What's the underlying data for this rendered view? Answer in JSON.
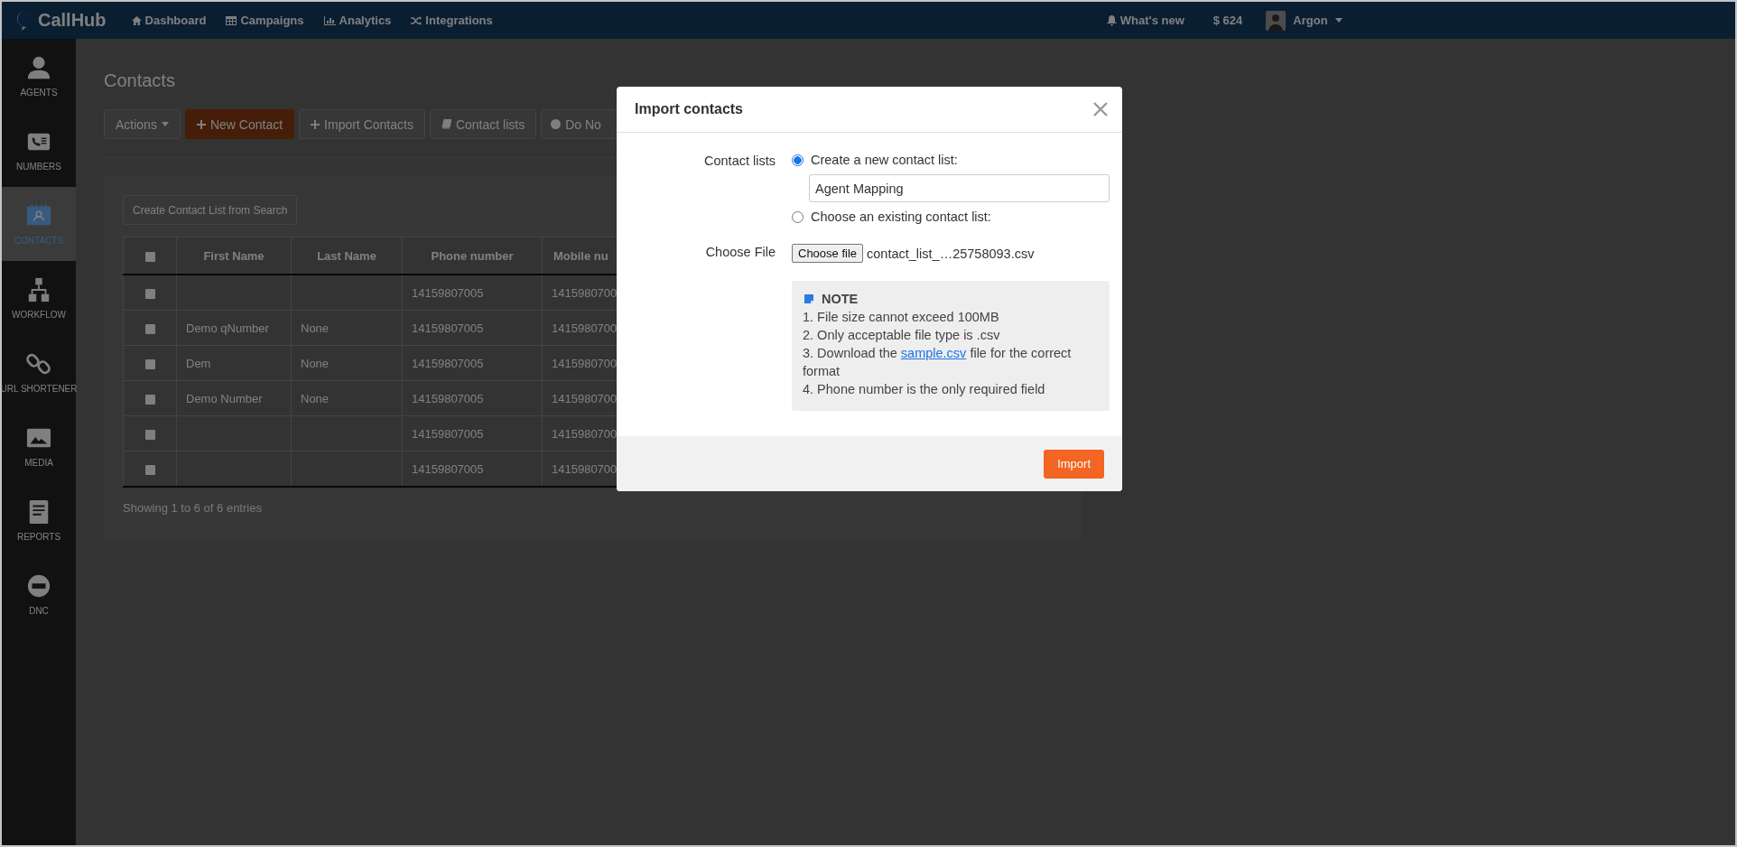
{
  "top_nav": {
    "logo": "CallHub",
    "items": [
      {
        "label": "Dashboard",
        "kind": "home"
      },
      {
        "label": "Campaigns",
        "kind": "table"
      },
      {
        "label": "Analytics",
        "kind": "chart"
      },
      {
        "label": "Integrations",
        "kind": "shuffle"
      }
    ],
    "whats_new": "What's new",
    "balance": "$ 624",
    "user": "Argon"
  },
  "sidebar": {
    "items": [
      {
        "label": "AGENTS",
        "kind": "person",
        "selected": false
      },
      {
        "label": "NUMBERS",
        "kind": "phone-card",
        "selected": false
      },
      {
        "label": "CONTACTS",
        "kind": "calendar",
        "selected": true
      },
      {
        "label": "WORKFLOW",
        "kind": "tree",
        "selected": false
      },
      {
        "label": "URL SHORTENER",
        "kind": "link",
        "selected": false
      },
      {
        "label": "MEDIA",
        "kind": "image",
        "selected": false
      },
      {
        "label": "REPORTS",
        "kind": "document",
        "selected": false
      },
      {
        "label": "DNC",
        "kind": "block",
        "selected": false
      }
    ]
  },
  "page": {
    "title": "Contacts",
    "toolbar": [
      {
        "label": "Actions",
        "kind": "dropdown"
      },
      {
        "label": "New Contact",
        "kind": "primary"
      },
      {
        "label": "Import Contacts",
        "kind": "add"
      },
      {
        "label": "Contact lists",
        "kind": "book"
      },
      {
        "label": "Do No",
        "kind": "block"
      }
    ],
    "create_list_button": "Create Contact List from Search",
    "table": {
      "select_all_checked": false,
      "columns": [
        "First Name",
        "Last Name",
        "Phone number",
        "Mobile nu"
      ],
      "rows": [
        {
          "checked": false,
          "phone": "14159807005",
          "mobile": "1415980700"
        },
        {
          "checked": false,
          "first_name": "Demo qNumber",
          "last_name": "None",
          "phone": "14159807005",
          "mobile": "1415980700"
        },
        {
          "checked": false,
          "first_name": "Dem",
          "last_name": "None",
          "phone": "14159807005",
          "mobile": "1415980700"
        },
        {
          "checked": false,
          "first_name": "Demo Number",
          "last_name": "None",
          "phone": "14159807005",
          "mobile": "1415980700"
        },
        {
          "checked": false,
          "phone": "14159807005",
          "mobile": "1415980700"
        },
        {
          "checked": false,
          "phone": "14159807005",
          "mobile": "1415980700"
        }
      ]
    },
    "entries_info": "Showing 1 to 6 of 6 entries"
  },
  "modal": {
    "title": "Import contacts",
    "contact_lists_label": "Contact lists",
    "options": [
      {
        "label": "Create a new contact list:",
        "selected": true,
        "value": "Agent Mapping"
      },
      {
        "label": "Choose an existing contact list:",
        "selected": false
      }
    ],
    "file_label": "Choose File",
    "file_button": "Choose file",
    "file_name": "contact_list_…25758093.csv",
    "note": {
      "heading": "NOTE",
      "lines": [
        {
          "text": "1. File size cannot exceed 100MB"
        },
        {
          "text": "2. Only acceptable file type is .csv"
        },
        {
          "text": "3. Download the ",
          "link": "sample.csv",
          "after": " file for the correct format"
        },
        {
          "text": "4. Phone number is the only required field"
        }
      ]
    },
    "import_button": "Import"
  }
}
